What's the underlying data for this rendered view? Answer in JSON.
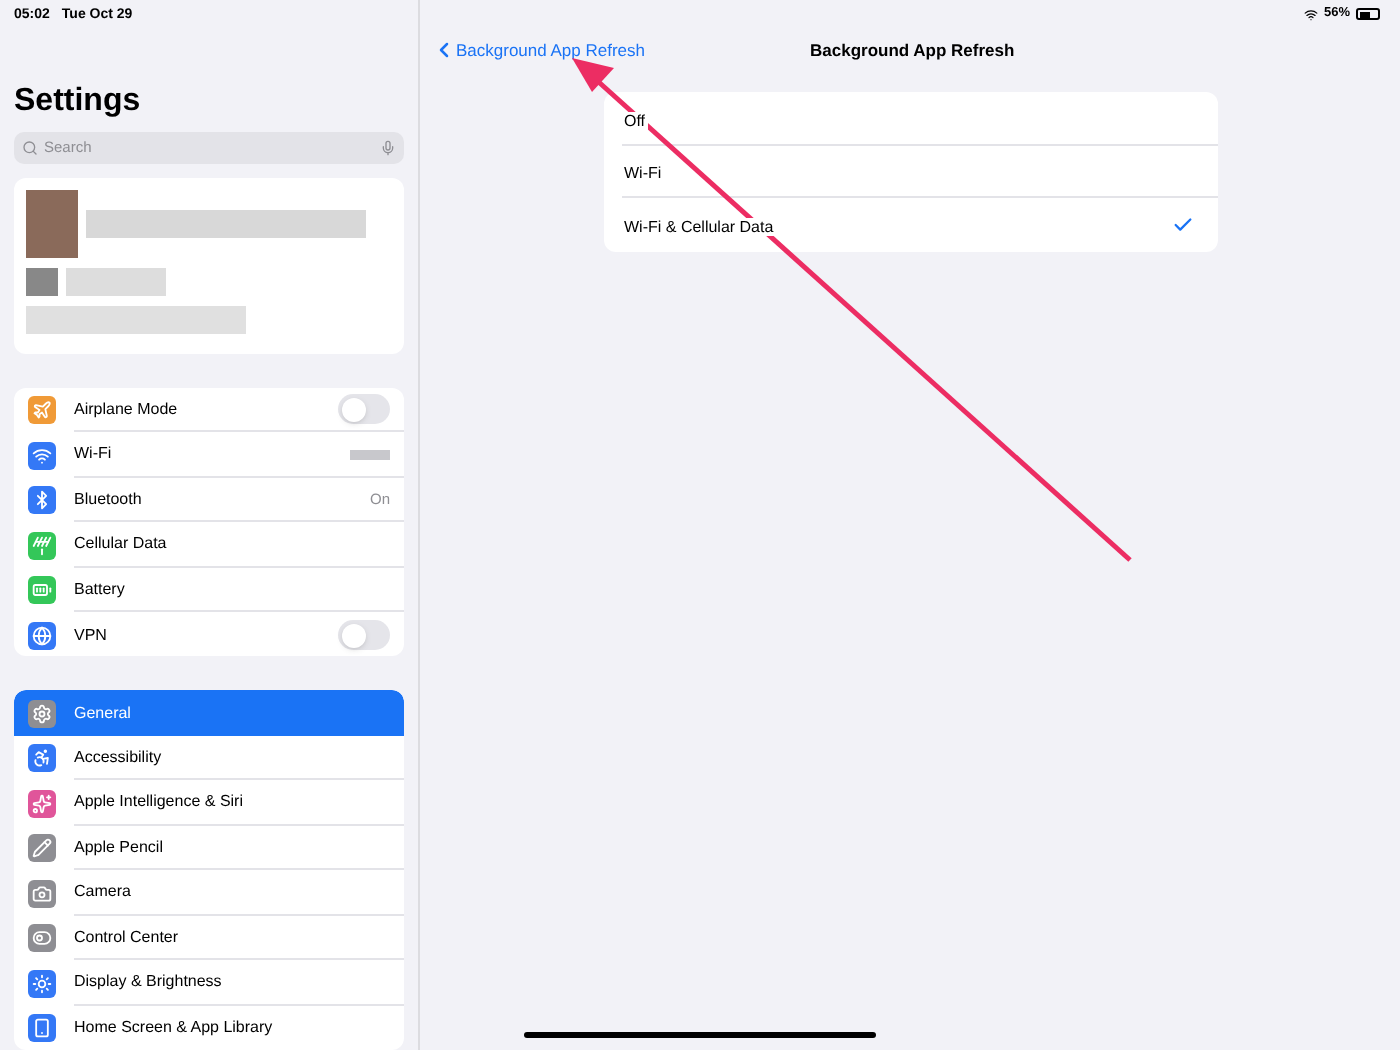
{
  "status_bar": {
    "time": "05:02",
    "date": "Tue Oct 29",
    "battery": "56%"
  },
  "sidebar": {
    "title": "Settings",
    "search": {
      "placeholder": "Search"
    },
    "groups": [
      [
        {
          "label": "Airplane Mode",
          "color": "#f09a37",
          "kind": "toggle",
          "on": false
        },
        {
          "label": "Wi-Fi",
          "color": "#3478f6",
          "kind": "hidden"
        },
        {
          "label": "Bluetooth",
          "color": "#3478f6",
          "kind": "value",
          "value": "On"
        },
        {
          "label": "Cellular Data",
          "color": "#34c759",
          "kind": "plain"
        },
        {
          "label": "Battery",
          "color": "#34c759",
          "kind": "plain"
        },
        {
          "label": "VPN",
          "color": "#3478f6",
          "kind": "toggle",
          "on": false
        }
      ],
      [
        {
          "label": "General",
          "color": "#8e8e93",
          "kind": "plain",
          "selected": true
        },
        {
          "label": "Accessibility",
          "color": "#3478f6",
          "kind": "plain",
          "selected": false
        },
        {
          "label": "Apple Intelligence & Siri",
          "color": "#e0559a",
          "kind": "plain",
          "selected": false
        },
        {
          "label": "Apple Pencil",
          "color": "#8e8e93",
          "kind": "plain",
          "selected": false
        },
        {
          "label": "Camera",
          "color": "#8e8e93",
          "kind": "plain",
          "selected": false
        },
        {
          "label": "Control Center",
          "color": "#8e8e93",
          "kind": "plain",
          "selected": false
        },
        {
          "label": "Display & Brightness",
          "color": "#3478f6",
          "kind": "plain",
          "selected": false
        },
        {
          "label": "Home Screen & App Library",
          "color": "#3478f6",
          "kind": "plain",
          "selected": false
        }
      ]
    ]
  },
  "detail": {
    "back": "Background App Refresh",
    "title": "Background App Refresh",
    "options": [
      {
        "label": "Off",
        "selected": false
      },
      {
        "label": "Wi-Fi",
        "selected": false
      },
      {
        "label": "Wi-Fi & Cellular Data",
        "selected": true
      }
    ]
  }
}
